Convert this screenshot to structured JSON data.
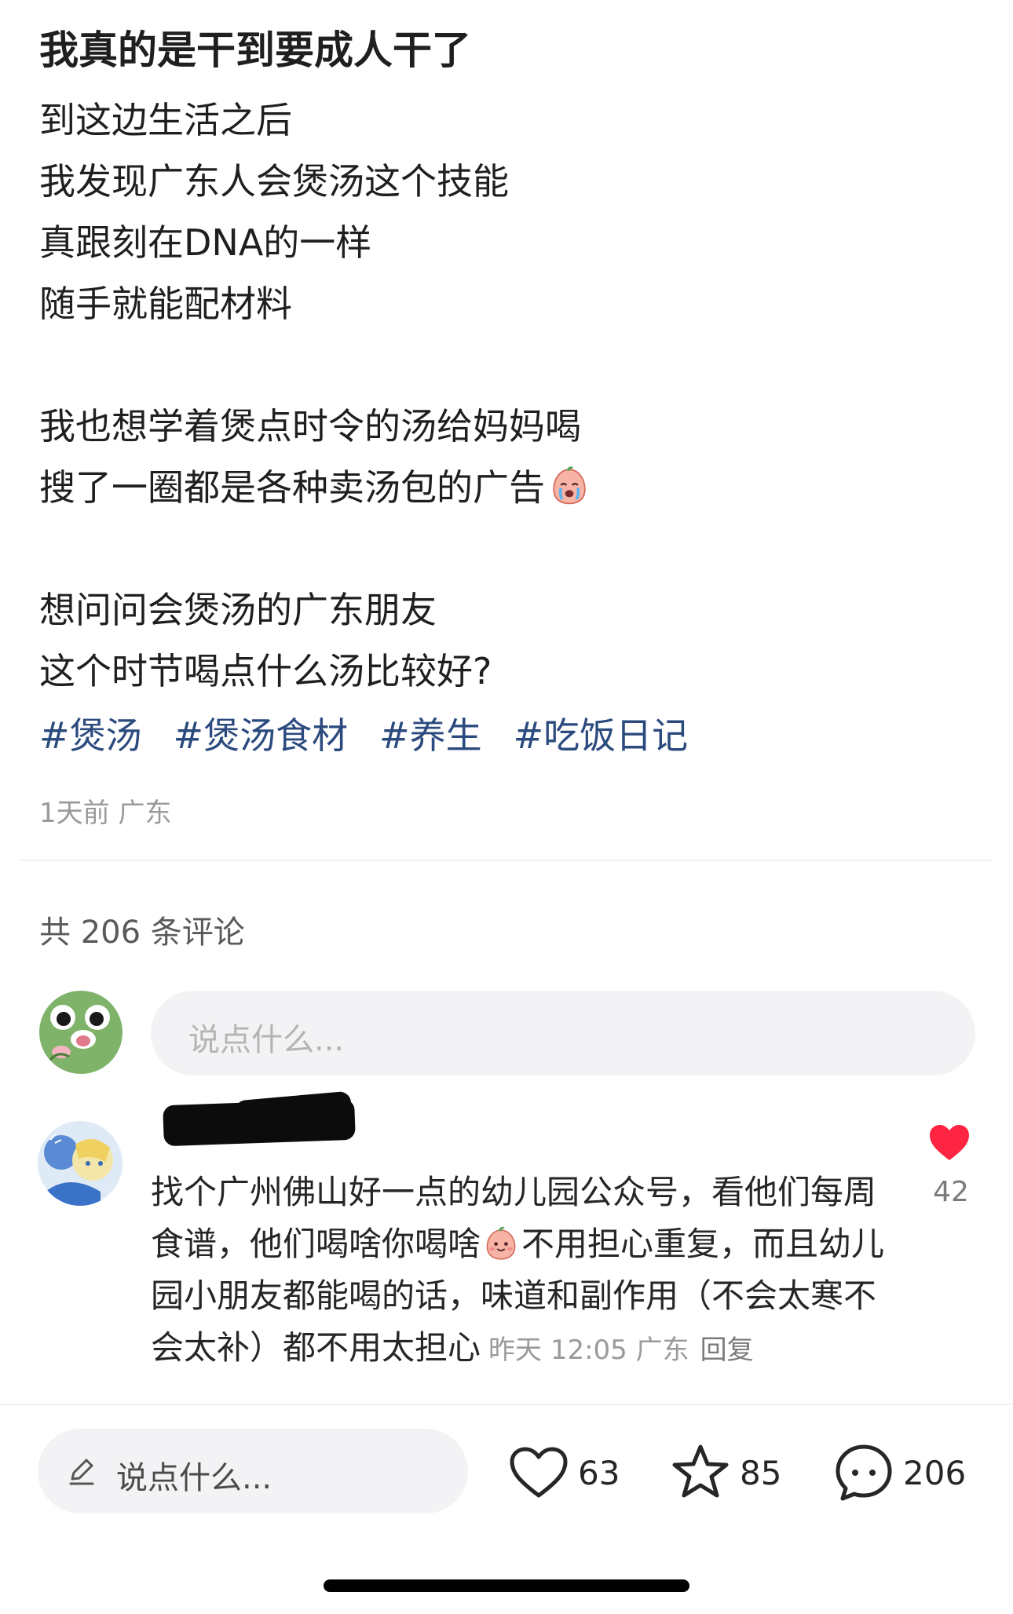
{
  "post": {
    "title": "我真的是干到要成人干了",
    "lines": [
      "到这边生活之后",
      "我发现广东人会煲汤这个技能",
      "真跟刻在DNA的一样",
      "随手就能配材料",
      "",
      "我也想学着煲点时令的汤给妈妈喝",
      "搜了一圈都是各种卖汤包的广告",
      "",
      "想问问会煲汤的广东朋友",
      "这个时节喝点什么汤比较好?"
    ],
    "tags": [
      "#煲汤",
      "#煲汤食材",
      "#养生",
      "#吃饭日记"
    ],
    "meta": "1天前 广东"
  },
  "comments_section": {
    "count_label": "共 206 条评论",
    "input_placeholder": "说点什么...",
    "comment": {
      "text_part1": "找个广州佛山好一点的幼儿园公众号，看他们每周食谱，他们喝啥你喝啥",
      "text_part2": "不用担心重复，而且幼儿园小朋友都能喝的话，味道和副作用（不会太寒不会太补）都不用太担心",
      "time": "昨天 12:05 广东",
      "reply_label": "回复",
      "likes": "42"
    }
  },
  "bottom_bar": {
    "input_placeholder": "说点什么...",
    "like_count": "63",
    "collect_count": "85",
    "comment_count": "206"
  },
  "colors": {
    "tag": "#2b4a7e",
    "like_red": "#ff2442"
  },
  "icons": [
    "crying-emoji-icon",
    "smile-emoji-icon",
    "heart-icon",
    "pencil-icon",
    "star-icon",
    "comment-bubble-icon",
    "frog-avatar"
  ]
}
